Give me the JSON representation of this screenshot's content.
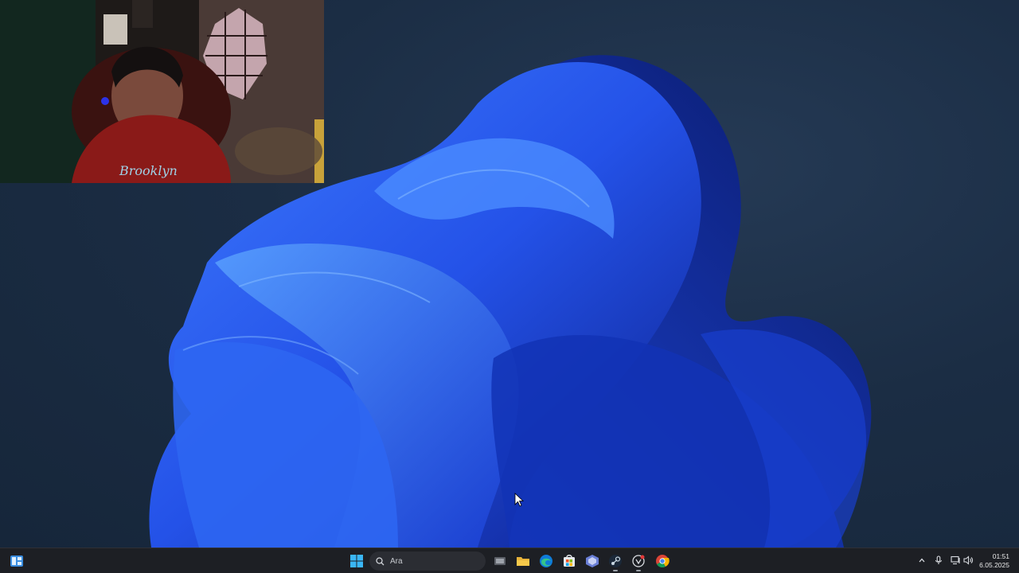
{
  "taskbar": {
    "search_placeholder": "Ara",
    "pinned_apps": [
      {
        "name": "task-view",
        "icon": "task-view-icon"
      },
      {
        "name": "file-explorer",
        "icon": "folder-icon"
      },
      {
        "name": "edge",
        "icon": "edge-icon"
      },
      {
        "name": "microsoft-store",
        "icon": "store-icon"
      },
      {
        "name": "app",
        "icon": "app-icon"
      },
      {
        "name": "steam",
        "icon": "steam-icon"
      },
      {
        "name": "app",
        "icon": "app-icon"
      },
      {
        "name": "chrome",
        "icon": "chrome-icon"
      }
    ],
    "tray": {
      "icons": [
        "chevron-up-icon",
        "microphone-icon",
        "network-icon",
        "volume-icon"
      ]
    },
    "clock": {
      "time": "01:51",
      "date": "6.05.2025"
    }
  },
  "colors": {
    "desktop_bg": "#1b2d44",
    "bloom_blue": "#2f5ff5",
    "taskbar_bg": "#1d1f24",
    "start_blue": "#3ab6f5"
  }
}
